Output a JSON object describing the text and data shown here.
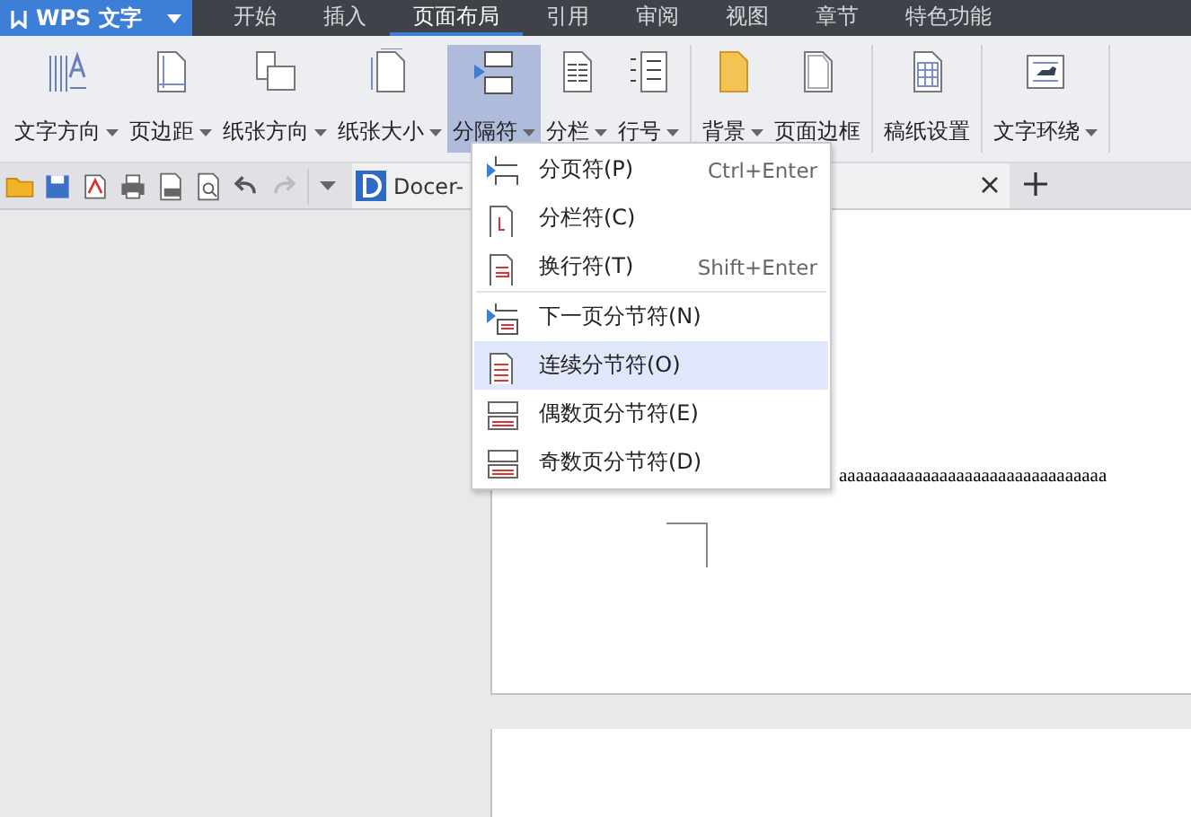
{
  "app_button": {
    "label": "WPS 文字"
  },
  "menu_tabs": [
    {
      "label": "开始",
      "selected": false
    },
    {
      "label": "插入",
      "selected": false
    },
    {
      "label": "页面布局",
      "selected": true
    },
    {
      "label": "引用",
      "selected": false
    },
    {
      "label": "审阅",
      "selected": false
    },
    {
      "label": "视图",
      "selected": false
    },
    {
      "label": "章节",
      "selected": false
    },
    {
      "label": "特色功能",
      "selected": false
    }
  ],
  "ribbon": {
    "groups": [
      [
        {
          "label": "文字方向",
          "dropdown": true,
          "pressed": false
        },
        {
          "label": "页边距",
          "dropdown": true,
          "pressed": false
        },
        {
          "label": "纸张方向",
          "dropdown": true,
          "pressed": false
        },
        {
          "label": "纸张大小",
          "dropdown": true,
          "pressed": false
        },
        {
          "label": "分隔符",
          "dropdown": true,
          "pressed": true
        },
        {
          "label": "分栏",
          "dropdown": true,
          "pressed": false
        },
        {
          "label": "行号",
          "dropdown": true,
          "pressed": false
        }
      ],
      [
        {
          "label": "背景",
          "dropdown": true,
          "pressed": false
        },
        {
          "label": "页面边框",
          "dropdown": false,
          "pressed": false
        }
      ],
      [
        {
          "label": "稿纸设置",
          "dropdown": false,
          "pressed": false
        }
      ],
      [
        {
          "label": "文字环绕",
          "dropdown": true,
          "pressed": false
        }
      ]
    ]
  },
  "doc_tab": {
    "title": "Docer-"
  },
  "page": {
    "text": "aaaaaaaaaaaaaaaaaaaaaaaaaaaaaaaa"
  },
  "dropdown_menu": {
    "groups": [
      [
        {
          "label": "分页符(P)",
          "shortcut": "Ctrl+Enter",
          "selected": false
        },
        {
          "label": "分栏符(C)",
          "selected": false
        },
        {
          "label": "换行符(T)",
          "shortcut": "Shift+Enter",
          "selected": false
        }
      ],
      [
        {
          "label": "下一页分节符(N)",
          "selected": false
        },
        {
          "label": "连续分节符(O)",
          "selected": true
        },
        {
          "label": "偶数页分节符(E)",
          "selected": false
        },
        {
          "label": "奇数页分节符(D)",
          "selected": false
        }
      ]
    ]
  }
}
